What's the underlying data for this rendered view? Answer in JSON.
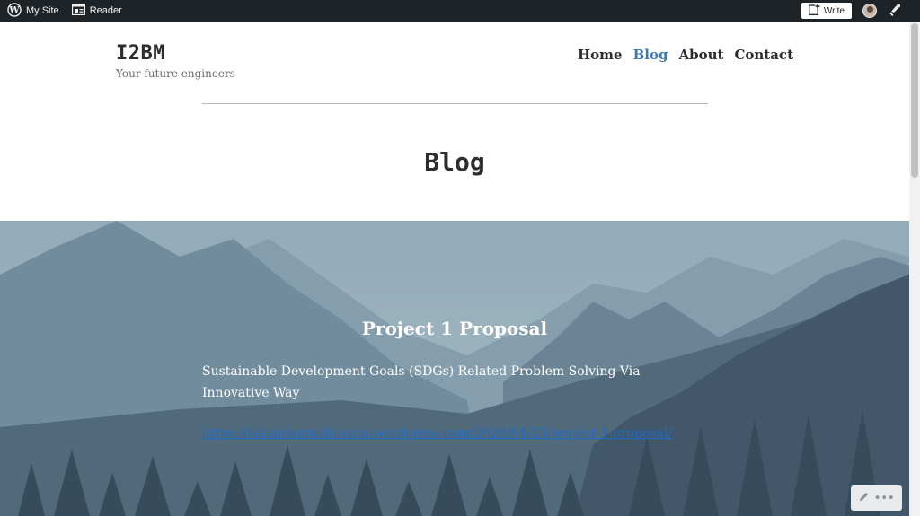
{
  "adminbar": {
    "my_site": "My Site",
    "reader": "Reader",
    "write": "Write"
  },
  "site": {
    "title": "I2BM",
    "tagline": "Your future engineers"
  },
  "nav": {
    "items": [
      {
        "label": "Home"
      },
      {
        "label": "Blog"
      },
      {
        "label": "About"
      },
      {
        "label": "Contact"
      }
    ],
    "active": "Blog"
  },
  "page": {
    "title": "Blog"
  },
  "post": {
    "title": "Project 1 Proposal",
    "body": "Sustainable Development Goals (SDGs) Related Problem Solving Via Innovative Way",
    "link": "https://iskandarzuldotcom.wordpress.com/2020/04/25/project-1-proposal/"
  },
  "widget": {
    "pencil_icon": "pencil-icon",
    "more_icon": "ellipsis-icon",
    "more_glyph": "•••"
  },
  "colors": {
    "adminbar": "#1d2327",
    "nav_active": "#3a78b9",
    "link": "#1f6bc4"
  }
}
